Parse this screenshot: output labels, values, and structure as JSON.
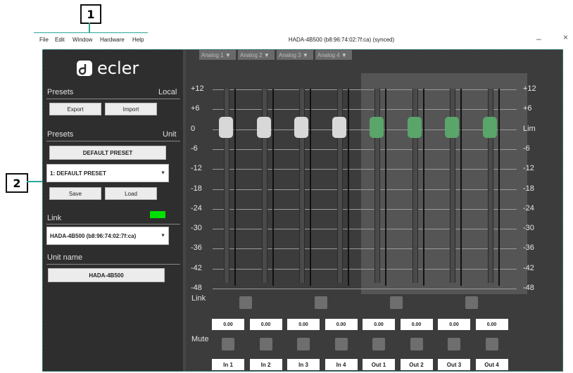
{
  "callouts": {
    "one": "1",
    "two": "2"
  },
  "menu": [
    "File",
    "Edit",
    "Window",
    "Hardware",
    "Help"
  ],
  "window": {
    "title": "HADA-4B500 (b8:96:74:02:7f:ca) (synced)",
    "minimize": "–",
    "close": "×"
  },
  "logo": {
    "brand": "ecler"
  },
  "presets_local": {
    "title": "Presets",
    "scope": "Local",
    "export_label": "Export",
    "import_label": "Import"
  },
  "presets_unit": {
    "title": "Presets",
    "scope": "Unit",
    "default_preset": "DEFAULT PRESET",
    "selected_preset": "1: DEFAULT PRESET",
    "save_label": "Save",
    "load_label": "Load"
  },
  "link": {
    "title": "Link",
    "status_color": "#00e000",
    "device": "HADA-4B500 (b8:96:74:02:7f:ca)"
  },
  "unit_name": {
    "title": "Unit name",
    "value": "HADA-4B500"
  },
  "tabs": [
    "Analog 1",
    "Analog 2",
    "Analog 3",
    "Analog 4"
  ],
  "scale_left": [
    "+12",
    "+6",
    "0",
    "-6",
    "-12",
    "-18",
    "-24",
    "-30",
    "-36",
    "-42",
    "-48"
  ],
  "scale_right": [
    "+12",
    "+6",
    "Lim",
    "-6",
    "-12",
    "-18",
    "-24",
    "-30",
    "-36",
    "-42",
    "-48"
  ],
  "row_labels": {
    "link": "Link",
    "mute": "Mute"
  },
  "channels": [
    {
      "name": "In 1",
      "value": "0.00",
      "type": "input"
    },
    {
      "name": "In 2",
      "value": "0.00",
      "type": "input"
    },
    {
      "name": "In 3",
      "value": "0.00",
      "type": "input"
    },
    {
      "name": "In 4",
      "value": "0.00",
      "type": "input"
    },
    {
      "name": "Out 1",
      "value": "0.00",
      "type": "output"
    },
    {
      "name": "Out 2",
      "value": "0.00",
      "type": "output"
    },
    {
      "name": "Out 3",
      "value": "0.00",
      "type": "output"
    },
    {
      "name": "Out 4",
      "value": "0.00",
      "type": "output"
    }
  ],
  "colors": {
    "callout_border": "#2aa89a",
    "input_knob": "#d8d8d8",
    "output_knob": "#5aa56a"
  }
}
